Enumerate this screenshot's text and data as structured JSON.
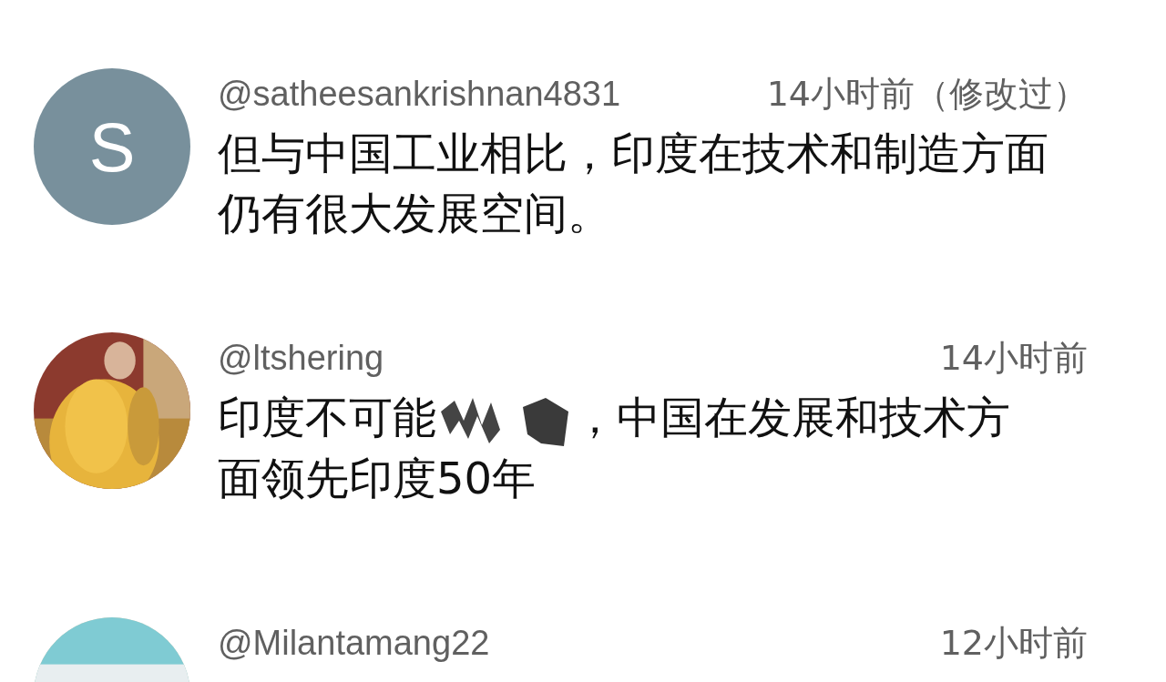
{
  "comments": [
    {
      "avatar": {
        "kind": "letter",
        "letter": "S"
      },
      "author": "@satheesankrishnan4831",
      "time": "14小时前（修改过）",
      "body": [
        {
          "kind": "text",
          "text": "但与中国工业相比，印度在技术和制造方面仍有很大发展空间。"
        }
      ]
    },
    {
      "author": "@ltshering",
      "time": "14小时前",
      "body": [
        {
          "kind": "text",
          "text": "印度不可能"
        },
        {
          "kind": "scribble"
        },
        {
          "kind": "text",
          "text": "，中国在发展和技术方"
        },
        {
          "kind": "text",
          "text": "面领先印度50年"
        }
      ]
    },
    {
      "author": "@Milantamang22",
      "time": "12小时前"
    }
  ]
}
